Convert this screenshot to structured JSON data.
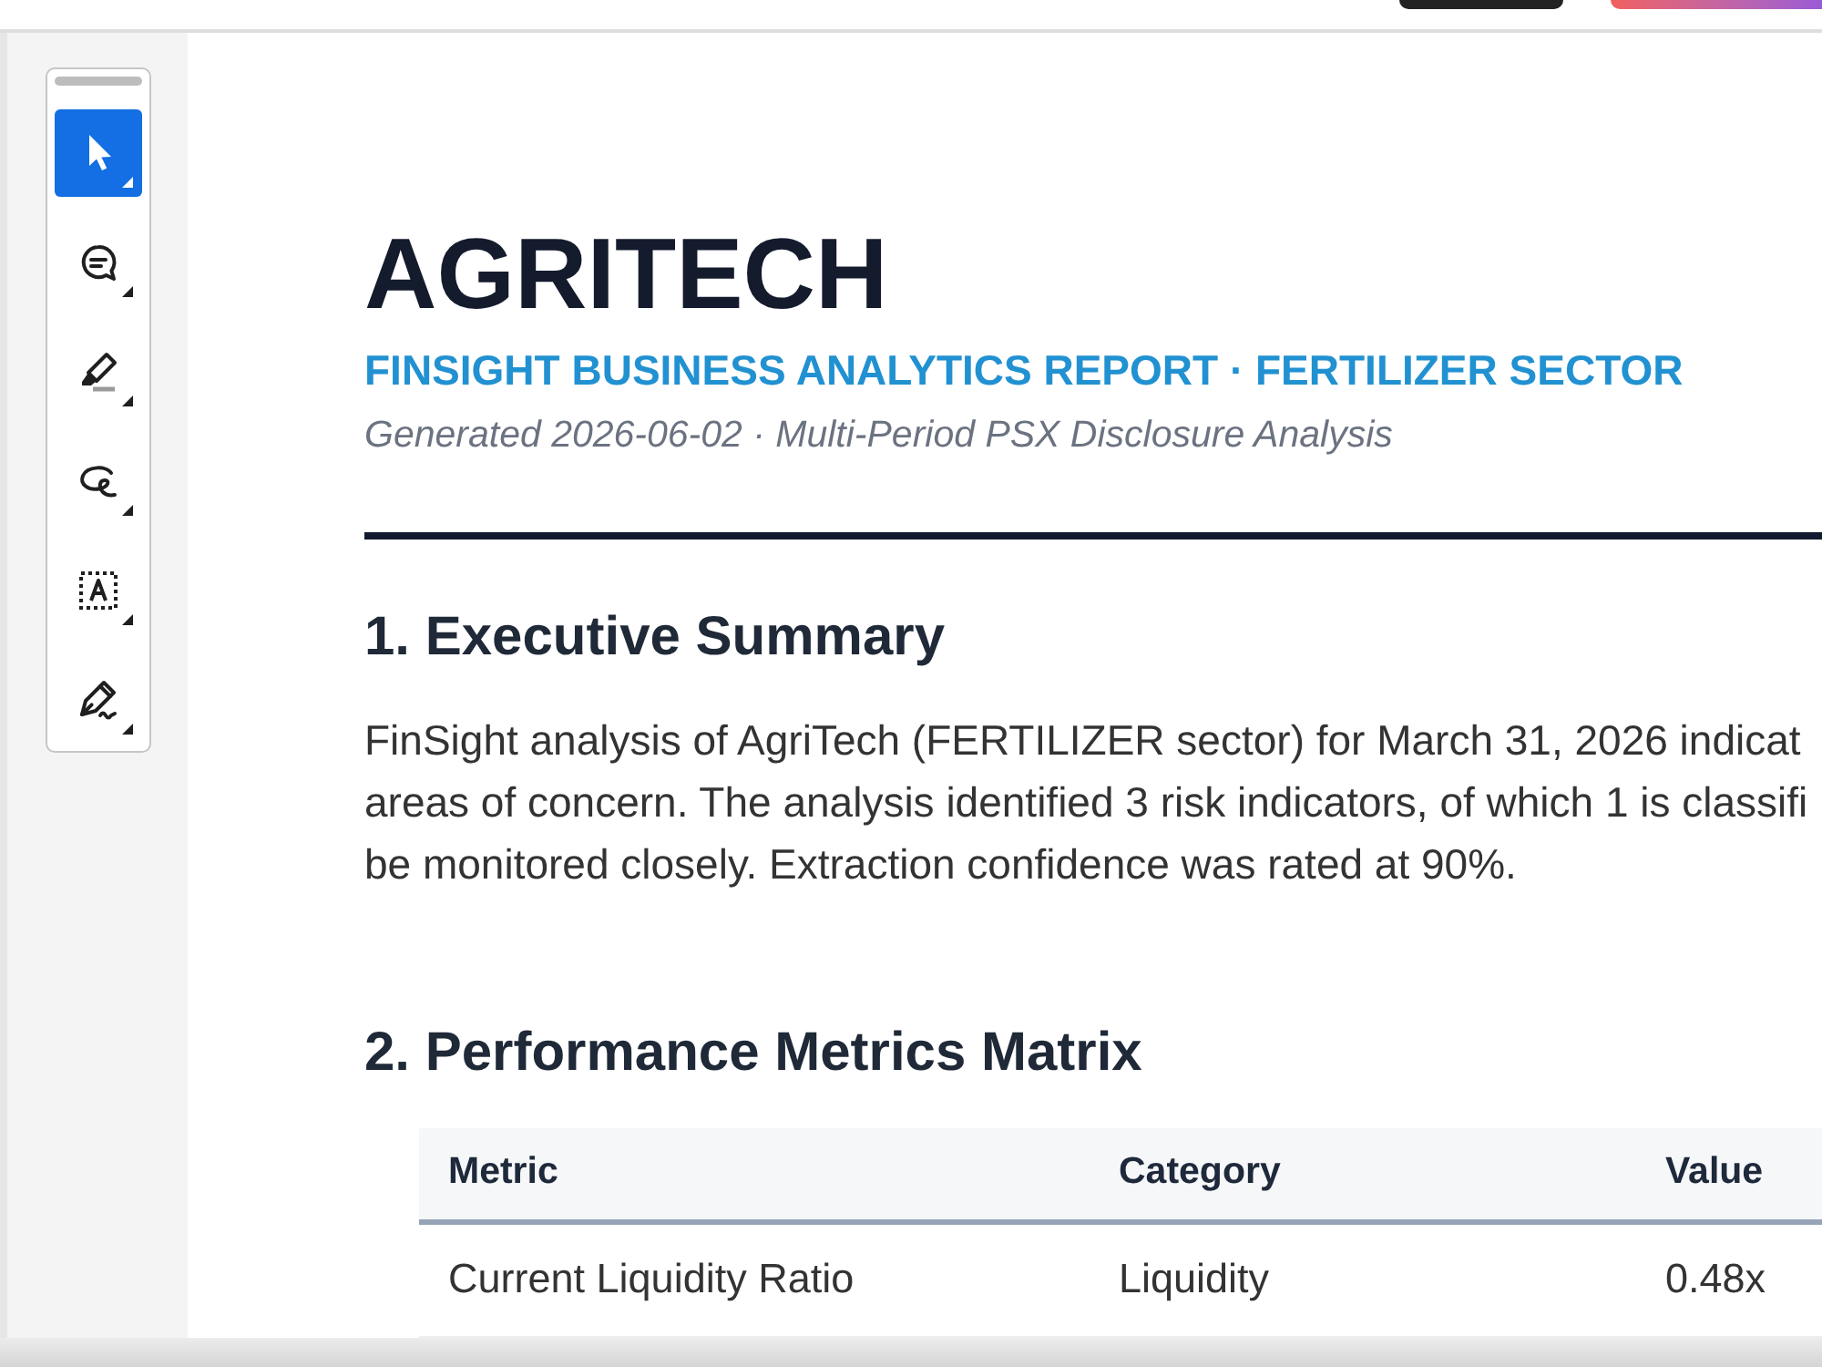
{
  "toolbar": {
    "tools": [
      {
        "kind": "select",
        "selected": true
      },
      {
        "kind": "comment",
        "selected": false
      },
      {
        "kind": "highlight",
        "selected": false
      },
      {
        "kind": "freehand",
        "selected": false
      },
      {
        "kind": "text_box",
        "selected": false
      },
      {
        "kind": "sign",
        "selected": false
      }
    ]
  },
  "report": {
    "title": "AGRITECH",
    "subtitle": "FINSIGHT BUSINESS ANALYTICS REPORT · FERTILIZER SECTOR",
    "generated": "Generated 2026-06-02 · Multi-Period PSX Disclosure Analysis",
    "sections": [
      {
        "kind": "text",
        "heading": "1. Executive Summary",
        "lines": [
          "FinSight analysis of AgriTech (FERTILIZER sector) for March 31, 2026 indicat",
          "areas of concern. The analysis identified 3 risk indicators, of which 1 is classifi",
          "be monitored closely. Extraction confidence was rated at 90%."
        ]
      },
      {
        "kind": "table",
        "heading": "2. Performance Metrics Matrix",
        "table": {
          "columns": [
            "Metric",
            "Category",
            "Value"
          ],
          "rows": [
            [
              "Current Liquidity Ratio",
              "Liquidity",
              "0.48x"
            ]
          ]
        }
      }
    ]
  }
}
